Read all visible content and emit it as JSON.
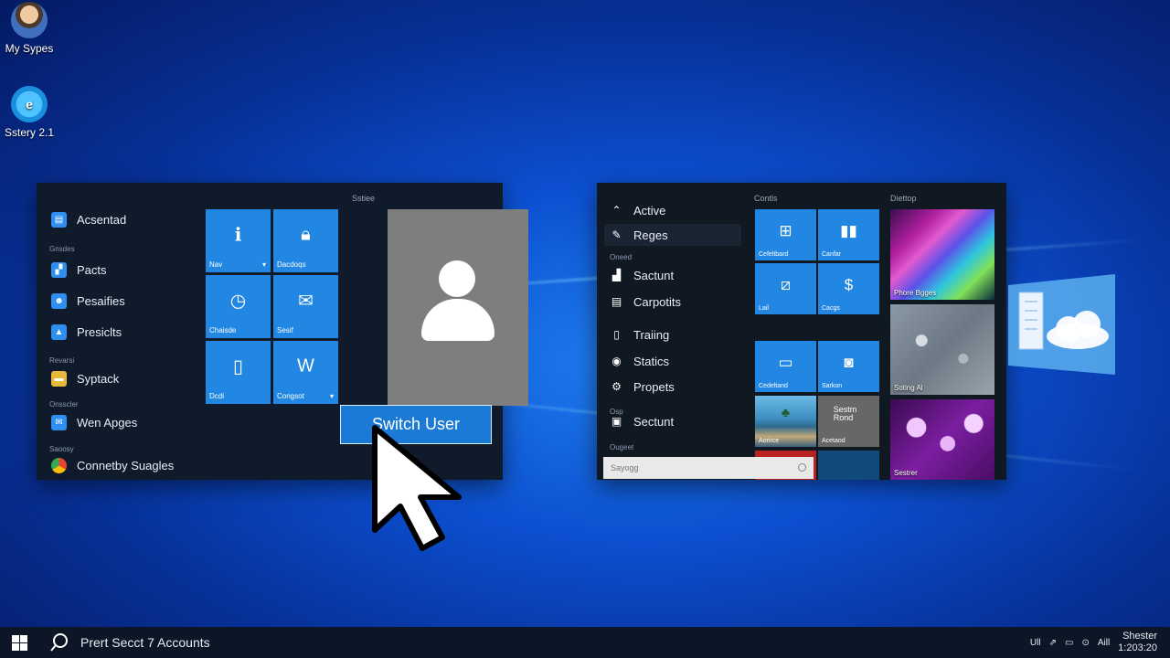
{
  "desktop": {
    "icons": [
      {
        "label": "My Sypes",
        "icon": "user-avatar-icon"
      },
      {
        "label": "Sstery 2.1",
        "icon": "browser-icon"
      }
    ]
  },
  "left_menu": {
    "groups": [
      "Gnsdes",
      "Revarsi",
      "Onsscler",
      "Saoosy"
    ],
    "nav_items": [
      {
        "label": "Acsentad",
        "icon": "list-icon"
      },
      {
        "label": "Pacts",
        "icon": "document-icon"
      },
      {
        "label": "Pesaifies",
        "icon": "people-icon"
      },
      {
        "label": "Presiclts",
        "icon": "chart-icon"
      },
      {
        "label": "Syptack",
        "icon": "folder-icon"
      },
      {
        "label": "Wen Apges",
        "icon": "mail-icon"
      },
      {
        "label": "Connetby Suagles",
        "icon": "chrome-icon"
      }
    ],
    "tiles_header": "Sstiee",
    "tiles": [
      {
        "label": "Nav",
        "icon": "info-icon",
        "chevron": "▾"
      },
      {
        "label": "Dacdoqs",
        "icon": "lock-icon",
        "chevron": ""
      },
      {
        "label": "Chaisde",
        "icon": "clock-icon",
        "chevron": ""
      },
      {
        "label": "Sesif",
        "icon": "mail-icon",
        "chevron": ""
      },
      {
        "label": "Dcdi",
        "icon": "file-icon",
        "chevron": ""
      },
      {
        "label": "Congsot",
        "icon": "word-icon",
        "chevron": "▾"
      }
    ],
    "switch_user_label": "Switch User"
  },
  "right_menu": {
    "nav_items": [
      {
        "label": "Active",
        "icon": "chevron-up-icon"
      },
      {
        "label": "Reges",
        "icon": "pen-icon"
      },
      {
        "label": "Sactunt",
        "icon": "chart-icon"
      },
      {
        "label": "Carpotits",
        "icon": "document-icon"
      },
      {
        "label": "Traiing",
        "icon": "phone-icon"
      },
      {
        "label": "Statics",
        "icon": "shield-icon"
      },
      {
        "label": "Propets",
        "icon": "gear-icon"
      },
      {
        "label": "Sectunt",
        "icon": "bag-icon"
      }
    ],
    "group_labels": [
      "Oneed",
      "Osp",
      "Ougeet"
    ],
    "headers": {
      "tiles": "Contls",
      "photos": "Diettop"
    },
    "tiles": [
      {
        "label": "Cefeltbard",
        "icon": "windows-icon"
      },
      {
        "label": "Canfar",
        "icon": "pause-icon"
      },
      {
        "label": "Lail",
        "icon": "edit-icon"
      },
      {
        "label": "Cacgs",
        "icon": "dollar-icon"
      },
      {
        "label": "Cedeltand",
        "icon": "window-icon"
      },
      {
        "label": "Sarkon",
        "icon": "camera-icon"
      },
      {
        "label": "Sestm Rond",
        "icon": "text-icon"
      }
    ],
    "photo_tiles": [
      {
        "label": "Phore Bgges"
      },
      {
        "label": "Soting Al"
      },
      {
        "label": "Sestrer"
      }
    ],
    "mini_tiles": [
      {
        "label": "Aorirce"
      },
      {
        "label": "Acetaod"
      }
    ],
    "search_placeholder": "Sayogg"
  },
  "taskbar": {
    "search_text": "Prert Secct 7 Accounts",
    "tray": [
      "Ull",
      "Aill"
    ],
    "clock_line1": "Shester",
    "clock_line2": "1:203:20"
  },
  "colors": {
    "accent": "#2187e3",
    "menu_bg": "#0f1a2b",
    "desktop_mid": "#0c4fd0"
  }
}
